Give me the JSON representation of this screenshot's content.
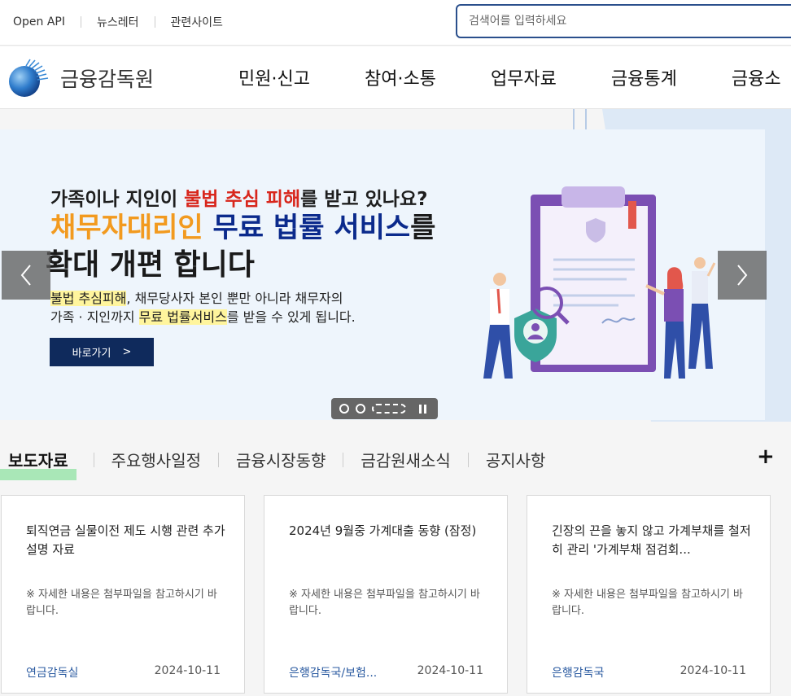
{
  "util": {
    "links": [
      "Open API",
      "뉴스레터",
      "관련사이트"
    ],
    "search_placeholder": "검색어를 입력하세요"
  },
  "logo": {
    "text": "금융감독원"
  },
  "menu": [
    "민원·신고",
    "참여·소통",
    "업무자료",
    "금융통계",
    "금융소"
  ],
  "banner": {
    "line1_pre": "가족이나 지인이 ",
    "line1_red": "불법 추심 피해",
    "line1_post": "를 받고 있나요?",
    "line2_orange": "채무자대리인",
    "line2_blue": " 무료 법률 서비스",
    "line2_post": "를",
    "line3": "확대 개편 합니다",
    "sub1_hl": "불법 추심피해",
    "sub1_post": ", 채무당사자 본인 뿐만 아니라 채무자의",
    "sub2_pre": "가족 · 지인까지 ",
    "sub2_hl": "무료 법률서비스",
    "sub2_post": "를 받을 수 있게 됩니다.",
    "button_label": "바로가기",
    "button_chevron": ">"
  },
  "carousel": {
    "prev": "‹",
    "next": "›",
    "pages": 3,
    "active_page": 3
  },
  "tabs": [
    "보도자료",
    "주요행사일정",
    "금융시장동향",
    "금감원새소식",
    "공지사항"
  ],
  "more_label": "+",
  "cards": [
    {
      "title": "퇴직연금 실물이전 제도 시행 관련 추가 설명 자료",
      "note": "※ 자세한 내용은 첨부파일을 참고하시기 바랍니다.",
      "dept": "연금감독실",
      "date": "2024-10-11"
    },
    {
      "title": "2024년 9월중 가계대출 동향 (잠정)",
      "note": "※ 자세한 내용은 첨부파일을 참고하시기 바랍니다.",
      "dept": "은행감독국/보험...",
      "date": "2024-10-11"
    },
    {
      "title": "긴장의 끈을 놓지 않고 가계부채를 철저히 관리 '가계부채 점검회...",
      "note": "※ 자세한 내용은 첨부파일을 참고하시기 바랍니다.",
      "dept": "은행감독국",
      "date": "2024-10-11"
    }
  ]
}
